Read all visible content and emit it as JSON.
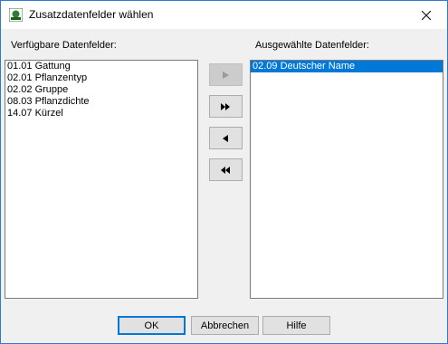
{
  "window": {
    "title": "Zusatzdatenfelder wählen"
  },
  "available": {
    "label": "Verfügbare Datenfelder:",
    "items": [
      "01.01 Gattung",
      "02.01 Pflanzentyp",
      "02.02 Gruppe",
      "08.03 Pflanzdichte",
      "14.07 Kürzel"
    ]
  },
  "selected": {
    "label": "Ausgewählte Datenfelder:",
    "items": [
      "02.09 Deutscher Name"
    ],
    "highlighted_index": 0
  },
  "move_buttons": {
    "add_icon": "arrow-right-icon",
    "add_all_icon": "double-arrow-right-icon",
    "remove_icon": "arrow-left-icon",
    "remove_all_icon": "double-arrow-left-icon",
    "add_enabled": false
  },
  "buttons": {
    "ok": "OK",
    "cancel": "Abbrechen",
    "help": "Hilfe"
  },
  "colors": {
    "selection": "#0078d7",
    "window_border": "#2b7bd6"
  }
}
